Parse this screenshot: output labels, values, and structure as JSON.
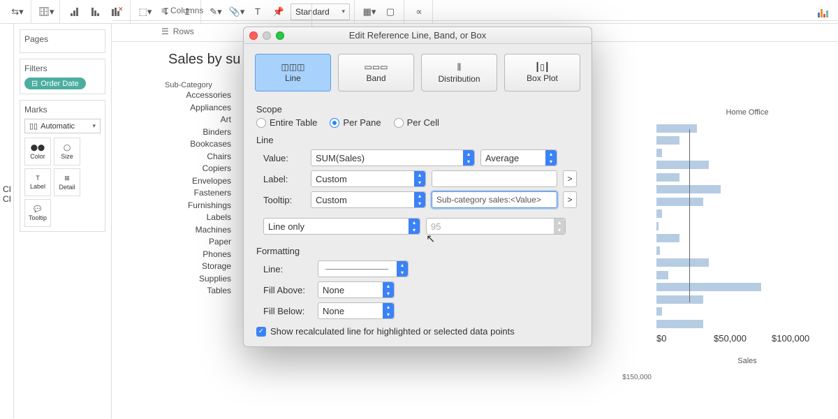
{
  "toolbar": {
    "format_selected": "Standard"
  },
  "shelves": {
    "columns": "Columns",
    "rows": "Rows"
  },
  "sidebar": {
    "pages_title": "Pages",
    "filters_title": "Filters",
    "filter_pill": "Order Date",
    "marks_title": "Marks",
    "marks_type": "Automatic",
    "marks": [
      "Color",
      "Size",
      "Label",
      "Detail",
      "Tooltip"
    ]
  },
  "leftstub": [
    "CI",
    "CI"
  ],
  "sheet": {
    "title": "Sales by su",
    "col_header": "Sub-Category",
    "rows": [
      "Accessories",
      "Appliances",
      "Art",
      "Binders",
      "Bookcases",
      "Chairs",
      "Copiers",
      "Envelopes",
      "Fasteners",
      "Furnishings",
      "Labels",
      "Machines",
      "Paper",
      "Phones",
      "Storage",
      "Supplies",
      "Tables"
    ]
  },
  "right_pane": {
    "header": "Home Office",
    "axis_ticks": [
      "$0",
      "$50,000",
      "$100,000"
    ],
    "left_tick": "$150,000",
    "axis_label": "Sales"
  },
  "dialog": {
    "title": "Edit Reference Line, Band, or Box",
    "tabs": [
      "Line",
      "Band",
      "Distribution",
      "Box Plot"
    ],
    "scope_title": "Scope",
    "scope_options": [
      "Entire Table",
      "Per Pane",
      "Per Cell"
    ],
    "scope_selected": "Per Pane",
    "line_section": "Line",
    "value_label": "Value:",
    "value_field": "SUM(Sales)",
    "value_agg": "Average",
    "label_label": "Label:",
    "label_mode": "Custom",
    "label_value": "",
    "tooltip_label": "Tooltip:",
    "tooltip_mode": "Custom",
    "tooltip_value": "Sub-category sales:<Value>",
    "lineonly": "Line only",
    "confidence": "95",
    "formatting_title": "Formatting",
    "fmt_line": "Line:",
    "fmt_above": "Fill Above:",
    "fmt_above_val": "None",
    "fmt_below": "Fill Below:",
    "fmt_below_val": "None",
    "recalc": "Show recalculated line for highlighted or selected data points"
  },
  "chart_data": {
    "type": "bar",
    "title": "Sales by Sub-Category (Home Office pane shown)",
    "categories": [
      "Accessories",
      "Appliances",
      "Art",
      "Binders",
      "Bookcases",
      "Chairs",
      "Copiers",
      "Envelopes",
      "Fasteners",
      "Furnishings",
      "Labels",
      "Machines",
      "Paper",
      "Phones",
      "Storage",
      "Supplies",
      "Tables"
    ],
    "values": [
      35000,
      20000,
      5000,
      45000,
      20000,
      55000,
      40000,
      5000,
      2000,
      20000,
      3000,
      45000,
      10000,
      90000,
      40000,
      5000,
      40000
    ],
    "reference_line": {
      "value": 28000,
      "agg": "Average"
    },
    "xlabel": "Sales",
    "xlim": [
      0,
      120000
    ]
  }
}
